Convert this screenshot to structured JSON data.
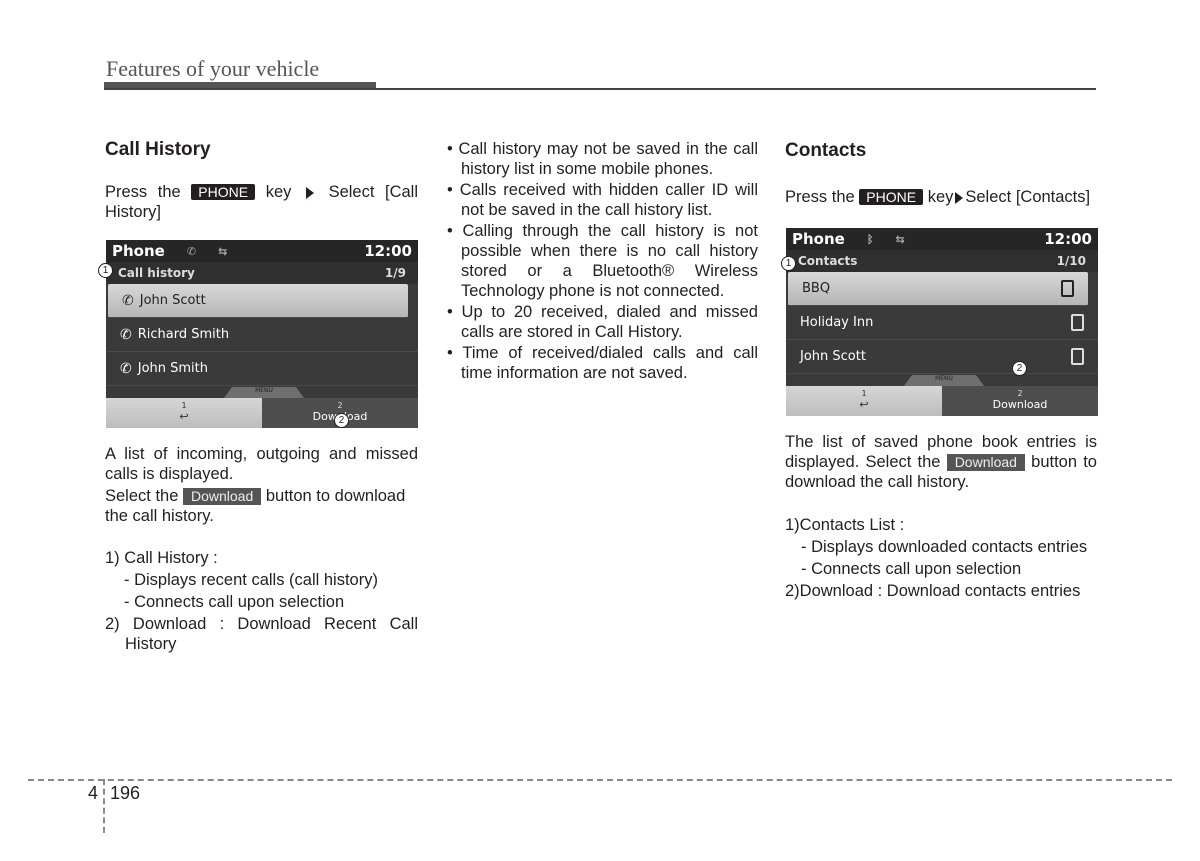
{
  "header": {
    "title": "Features of your vehicle"
  },
  "call_history": {
    "heading": "Call History",
    "instruction": {
      "pre": "Press the",
      "key": "PHONE",
      "mid": "key",
      "post": "Select [Call History]"
    },
    "screen": {
      "title": "Phone",
      "time": "12:00",
      "status_icons": [
        "phone-icon",
        "usb-icon"
      ],
      "subtitle": "Call history",
      "page": "1/9",
      "rows": [
        {
          "name": "John Scott",
          "icon": "outgoing-call-icon",
          "selected": true
        },
        {
          "name": "Richard Smith",
          "icon": "missed-call-icon",
          "selected": false
        },
        {
          "name": "John Smith",
          "icon": "missed-call-icon",
          "selected": false
        }
      ],
      "menu_label": "MENU",
      "btn1_num": "1",
      "btn1_icon": "back-icon",
      "btn2_num": "2",
      "btn2_label": "Download"
    },
    "callouts": [
      "1",
      "2"
    ],
    "desc1": "A list of incoming, outgoing and missed calls is displayed.",
    "desc2_pre": "Select the",
    "desc2_btn": "Download",
    "desc2_post": "button to download the call history.",
    "list": [
      {
        "label": "1) Call History :",
        "subs": [
          "- Displays recent calls (call history)",
          "- Connects call upon selection"
        ]
      },
      {
        "label": "2) Download : Download Recent Call History",
        "subs": []
      }
    ]
  },
  "notes": [
    "Call history may not be saved in the call history list in some mobile phones.",
    "Calls received with hidden caller ID will not be saved in the call history list.",
    "Calling through the call history is not possible when there is no call history stored or a Bluetooth® Wireless Technology phone is not connected.",
    "Up to 20 received, dialed and missed calls are stored in Call History.",
    "Time of received/dialed calls and call time information are not saved."
  ],
  "contacts": {
    "heading": "Contacts",
    "instruction": {
      "pre": "Press the",
      "key": "PHONE",
      "mid": "key",
      "post": "Select [Contacts]"
    },
    "screen": {
      "title": "Phone",
      "time": "12:00",
      "status_icons": [
        "bluetooth-icon",
        "usb-icon"
      ],
      "subtitle": "Contacts",
      "page": "1/10",
      "rows": [
        {
          "name": "BBQ",
          "icon": "mobile-phone-icon",
          "selected": true
        },
        {
          "name": "Holiday Inn",
          "icon": "mobile-phone-icon",
          "selected": false
        },
        {
          "name": "John Scott",
          "icon": "mobile-phone-icon",
          "selected": false
        }
      ],
      "menu_label": "MENU",
      "btn1_num": "1",
      "btn1_icon": "back-icon",
      "btn2_num": "2",
      "btn2_label": "Download"
    },
    "callouts": [
      "1",
      "2"
    ],
    "desc_pre": "The list of saved phone book entries is displayed. Select the",
    "desc_btn": "Download",
    "desc_post": "button to download the call history.",
    "list": [
      {
        "label": "1)Contacts List :",
        "subs": [
          "- Displays downloaded contacts entries",
          "- Connects call upon selection"
        ]
      },
      {
        "label": "2)Download : Download contacts entries",
        "subs": []
      }
    ]
  },
  "footer": {
    "section": "4",
    "page": "196"
  }
}
